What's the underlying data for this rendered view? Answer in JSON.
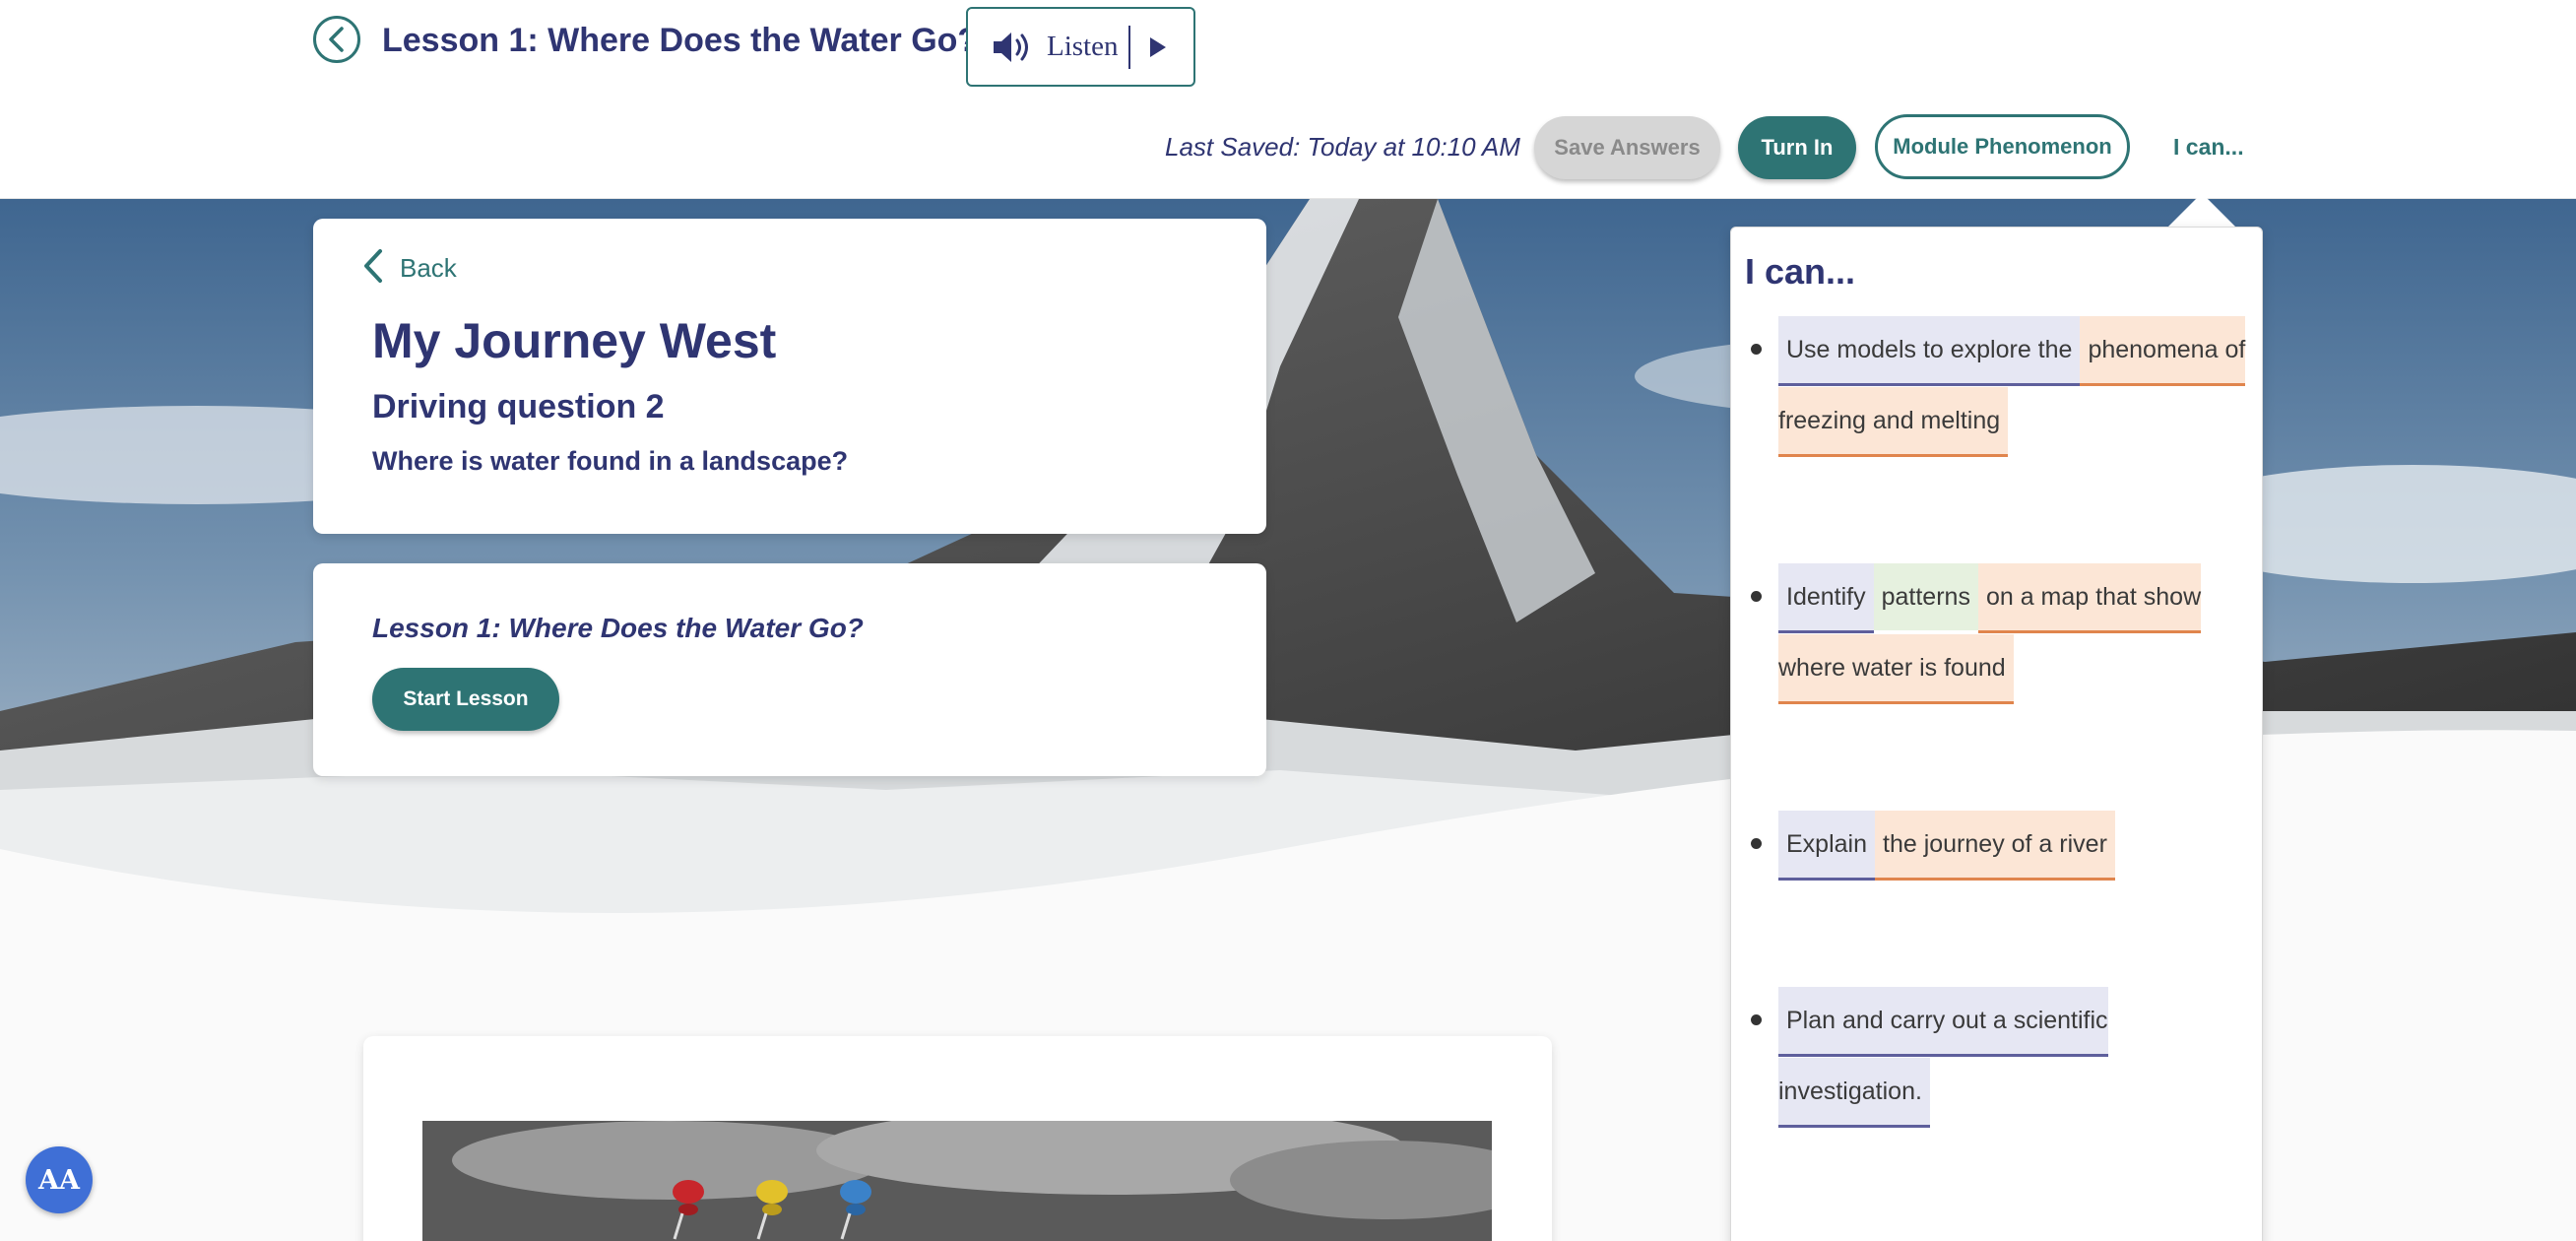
{
  "header": {
    "back_icon": "back-circle-icon",
    "lesson_title": "Lesson 1: Where Does the Water Go?",
    "listen_label": "Listen",
    "speaker_icon": "speaker-icon",
    "play_icon": "play-icon",
    "last_saved": "Last Saved: Today at 10:10 AM",
    "save_answers": "Save Answers",
    "turn_in": "Turn In",
    "module_phenomenon": "Module Phenomenon",
    "ican_link": "I can..."
  },
  "journey_card": {
    "back_label": "Back",
    "title": "My Journey West",
    "driving_question_label": "Driving question 2",
    "driving_question": "Where is water found in a landscape?"
  },
  "lesson_card": {
    "lesson_link": "Lesson 1: Where Does the Water Go?",
    "start_button": "Start Lesson"
  },
  "ican_panel": {
    "title": "I can...",
    "items": [
      {
        "segments": [
          {
            "text": "Use models to explore the",
            "tag": "blue"
          },
          {
            "text": "phenomena of freezing and melting",
            "tag": "orange"
          }
        ]
      },
      {
        "segments": [
          {
            "text": "Identify",
            "tag": "blue"
          },
          {
            "text": "patterns",
            "tag": "green"
          },
          {
            "text": "on a map that show where water is found",
            "tag": "orange"
          }
        ]
      },
      {
        "segments": [
          {
            "text": "Explain",
            "tag": "blue"
          },
          {
            "text": "the journey of a river",
            "tag": "orange"
          }
        ]
      },
      {
        "segments": [
          {
            "text": "Plan and carry out a scientific investigation.",
            "tag": "blue"
          }
        ]
      }
    ]
  },
  "accessibility": {
    "label": "AA"
  },
  "colors": {
    "accent": "#2e7474",
    "navy": "#2f3572",
    "highlight_blue": "#e6e7f3",
    "highlight_orange": "#fce6d6",
    "highlight_green": "#e6f1df"
  }
}
